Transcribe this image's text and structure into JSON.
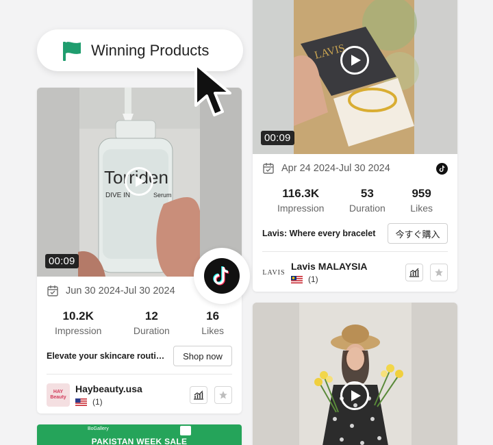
{
  "banner": {
    "title": "Winning Products"
  },
  "cards": [
    {
      "brand_text": "Torriden",
      "product_line": "DIVE IN",
      "product_type": "Serum",
      "duration_badge": "00:09",
      "date_range": "Jun 30 2024-Jul 30 2024",
      "stats": [
        {
          "value": "10.2K",
          "label": "Impression"
        },
        {
          "value": "12",
          "label": "Duration"
        },
        {
          "value": "16",
          "label": "Likes"
        }
      ],
      "description": "Elevate your skincare routine",
      "cta_label": "Shop now",
      "shop_logo_text": "HAY Beauty",
      "shop_name": "Haybeauty.usa",
      "region_count": "(1)"
    },
    {
      "box_text": "LAVIS",
      "duration_badge": "00:09",
      "date_range": "Apr 24 2024-Jul 30 2024",
      "stats": [
        {
          "value": "116.3K",
          "label": "Impression"
        },
        {
          "value": "53",
          "label": "Duration"
        },
        {
          "value": "959",
          "label": "Likes"
        }
      ],
      "description": "Lavis: Where every bracelet",
      "cta_label": "今すぐ購入",
      "shop_logo_text": "LAVIS",
      "shop_name": "Lavis MALAYSIA",
      "region_count": "(1)"
    }
  ],
  "bottom_banner": {
    "brand": "BoGallery",
    "title": "PAKISTAN WEEK SALE"
  },
  "colors": {
    "accent_green": "#1f9d6e",
    "tiktok_black": "#111111",
    "star_gray": "#bdbdbd"
  }
}
